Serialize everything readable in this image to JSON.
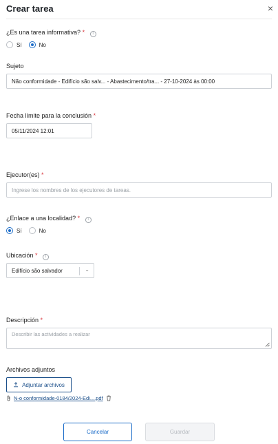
{
  "header": {
    "title": "Crear tarea",
    "close_glyph": "×"
  },
  "informative": {
    "label": "¿Es una tarea informativa?",
    "required_mark": "*",
    "options": [
      {
        "label": "Sí",
        "checked": false
      },
      {
        "label": "No",
        "checked": true
      }
    ]
  },
  "subject": {
    "label": "Sujeto",
    "value": "Não conformidade - Edifício são salv... - Abastecimento/tra... - 27-10-2024 às 00:00"
  },
  "deadline": {
    "label": "Fecha límite para la conclusión",
    "required_mark": "*",
    "value": "05/11/2024 12:01"
  },
  "executors": {
    "label": "Ejecutor(es)",
    "required_mark": "*",
    "placeholder": "Ingrese los nombres de los ejecutores de tareas."
  },
  "location_link": {
    "label": "¿Enlace a una localidad?",
    "required_mark": "*",
    "options": [
      {
        "label": "Sí",
        "checked": true
      },
      {
        "label": "No",
        "checked": false
      }
    ]
  },
  "location": {
    "label": "Ubicación",
    "required_mark": "*",
    "value": "Edifício são salvador"
  },
  "description": {
    "label": "Descripción",
    "required_mark": "*",
    "placeholder": "Describir las actividades a realizar"
  },
  "attachments": {
    "label": "Archivos adjuntos",
    "button_label": "Adjuntar archivos",
    "files": [
      {
        "name": "N-o conformidade-0184/2024-Edi....pdf"
      }
    ]
  },
  "footer": {
    "cancel_label": "Cancelar",
    "save_label": "Guardar"
  },
  "icons": {
    "info": "info-circle-icon",
    "close": "close-icon",
    "chevron": "chevron-down-icon",
    "upload": "upload-icon",
    "paperclip": "paperclip-icon",
    "trash": "trash-icon",
    "resize": "resize-handle-icon"
  },
  "colors": {
    "accent": "#1b6cc8",
    "required": "#d9363e",
    "link": "#1b4f8a"
  }
}
